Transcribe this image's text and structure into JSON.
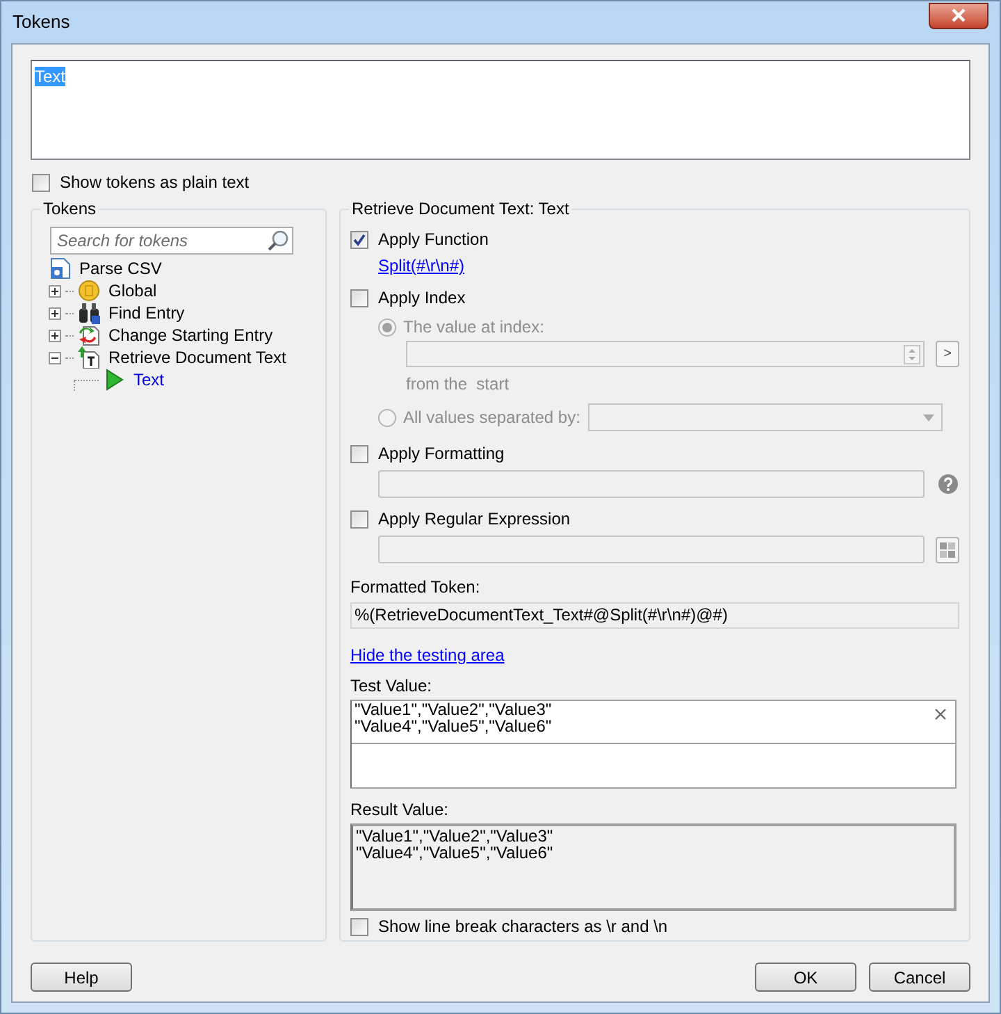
{
  "window": {
    "title": "Tokens"
  },
  "token_editor": {
    "value": "Text",
    "selected": true
  },
  "show_plain_text": {
    "label": "Show tokens as plain text",
    "checked": false
  },
  "tokens_panel": {
    "title": "Tokens",
    "search": {
      "placeholder": "Search for tokens"
    },
    "tree": [
      {
        "label": "Parse CSV",
        "kind": "document",
        "selected": false,
        "children": [
          {
            "label": "Global",
            "kind": "coin",
            "expanded": false,
            "selected": false
          },
          {
            "label": "Find Entry",
            "kind": "binoculars",
            "expanded": false,
            "selected": false
          },
          {
            "label": "Change Starting Entry",
            "kind": "change",
            "expanded": false,
            "selected": false
          },
          {
            "label": "Retrieve Document Text",
            "kind": "retrieve",
            "expanded": true,
            "selected": false,
            "children": [
              {
                "label": "Text",
                "kind": "token",
                "selected": true
              }
            ]
          }
        ]
      }
    ]
  },
  "details": {
    "title": "Retrieve Document Text: Text",
    "apply_function": {
      "label": "Apply Function",
      "checked": true,
      "link": "Split(#\\r\\n#)"
    },
    "apply_index": {
      "label": "Apply Index",
      "checked": false,
      "index_button": ">",
      "from_label": "from the  start",
      "modes": [
        {
          "kind": "index",
          "label": "The value at index:",
          "selected": true
        },
        {
          "kind": "separator",
          "label": "All values separated by:",
          "selected": false
        }
      ]
    },
    "apply_formatting": {
      "label": "Apply Formatting",
      "checked": false
    },
    "apply_regex": {
      "label": "Apply Regular Expression",
      "checked": false
    },
    "formatted_token": {
      "label": "Formatted Token:",
      "value": "%(RetrieveDocumentText_Text#@Split(#\\r\\n#)@#)"
    },
    "testing_link": "Hide the testing area",
    "test_value": {
      "label": "Test Value:",
      "value": "\"Value1\",\"Value2\",\"Value3\"\n\"Value4\",\"Value5\",\"Value6\""
    },
    "result_value": {
      "label": "Result Value:",
      "value": "\"Value1\",\"Value2\",\"Value3\"\n\"Value4\",\"Value5\",\"Value6\""
    },
    "show_line_breaks": {
      "label": "Show line break characters as \\r and \\n",
      "checked": false
    }
  },
  "buttons": [
    {
      "label": "Help"
    },
    {
      "label": "OK"
    },
    {
      "label": "Cancel"
    }
  ]
}
